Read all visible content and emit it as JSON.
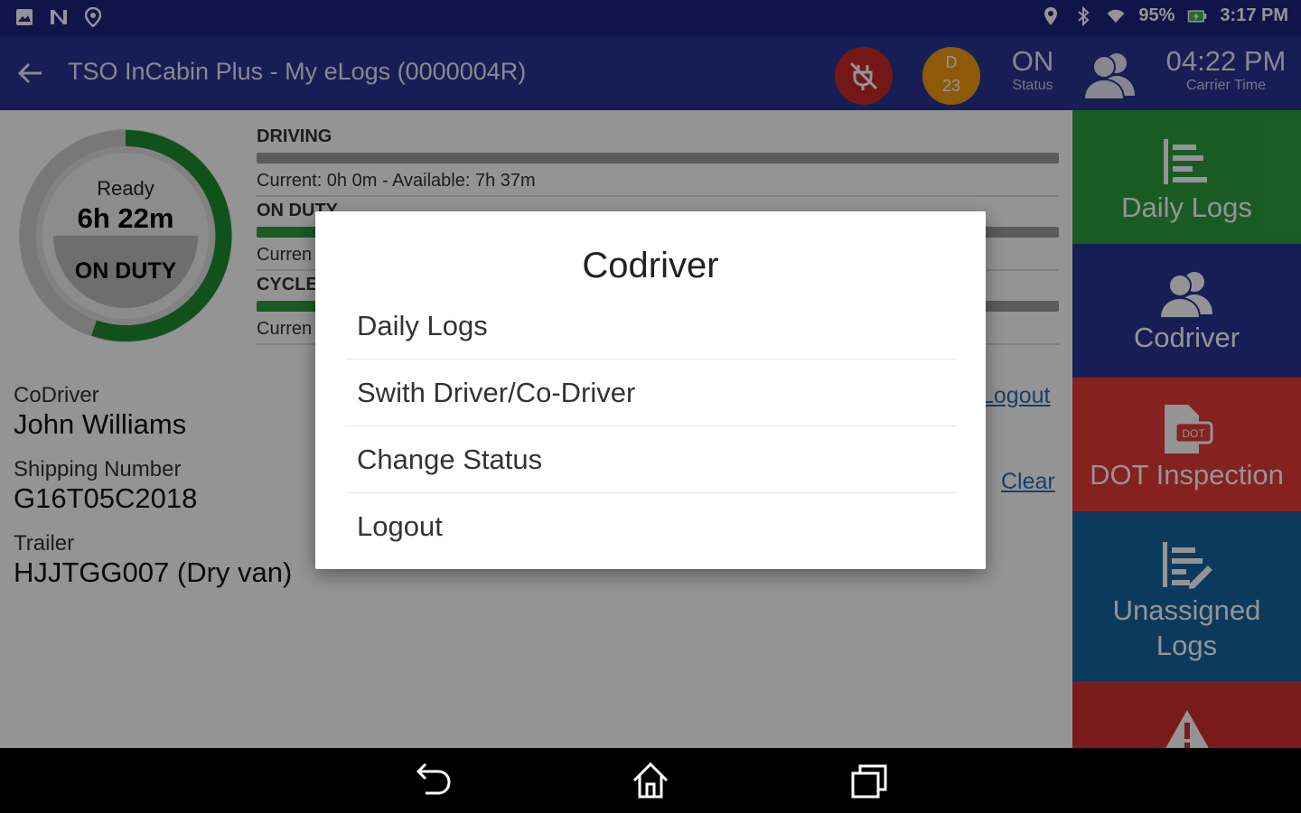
{
  "statusbar": {
    "battery": "95%",
    "time": "3:17 PM",
    "icons": [
      "image-icon",
      "n-icon",
      "location-pin-icon",
      "bluetooth-icon",
      "wifi-icon",
      "battery-charging-icon"
    ]
  },
  "appbar": {
    "title": "TSO InCabin Plus - My eLogs (0000004R)",
    "badge_letter": "D",
    "badge_number": "23",
    "status_value": "ON",
    "status_label": "Status",
    "carrier_time": "04:22 PM",
    "carrier_time_label": "Carrier Time",
    "colors": {
      "status_bar": "#1a237e",
      "app_bar": "#283593",
      "plug_badge": "#c62828",
      "d_badge": "#f39c12"
    }
  },
  "gauge": {
    "ready_label": "Ready",
    "time": "6h 22m",
    "status": "ON DUTY"
  },
  "bars": {
    "driving": {
      "title": "DRIVING",
      "caption": "Current: 0h 0m - Available: 7h 37m",
      "fill": 0.0
    },
    "on_duty": {
      "title": "ON DUTY",
      "caption": "Curren",
      "fill": 0.2
    },
    "cycle": {
      "title": "CYCLE",
      "caption": "Curren",
      "fill": 0.15
    }
  },
  "info": {
    "codriver_label": "CoDriver",
    "codriver_value": "John Williams",
    "shipping_label": "Shipping Number",
    "shipping_value": "G16T05C2018",
    "trailer_label": "Trailer",
    "trailer_value": "HJJTGG007 (Dry van)",
    "logout_link": "Logout",
    "clear_link": "Clear"
  },
  "sidebar": {
    "daily_logs": "Daily Logs",
    "codriver": "Codriver",
    "dot_inspection": "DOT Inspection",
    "unassigned_line1": "Unassigned",
    "unassigned_line2": "Logs",
    "colors": {
      "daily_logs": "#2e9e3e",
      "codriver": "#283593",
      "dot": "#e53935",
      "unassigned": "#1565a0",
      "alert": "#d32f2f"
    }
  },
  "dialog": {
    "title": "Codriver",
    "items": [
      "Daily Logs",
      "Swith Driver/Co-Driver",
      "Change Status",
      "Logout"
    ]
  }
}
